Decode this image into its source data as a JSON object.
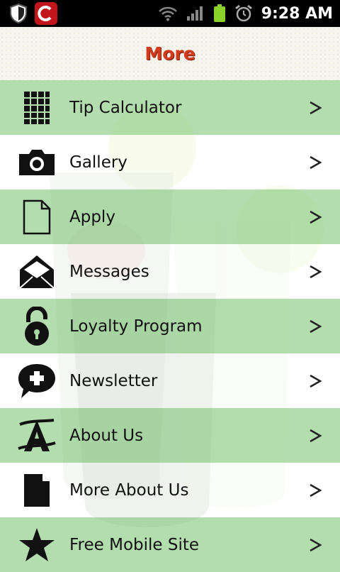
{
  "status_bar": {
    "time": "9:28 AM",
    "icons": [
      "shield-icon",
      "app-badge-icon",
      "wifi-icon",
      "signal-icon",
      "battery-icon",
      "alarm-icon"
    ]
  },
  "header": {
    "title": "More"
  },
  "colors": {
    "title": "#d23b1e",
    "row_green": "#a8d8a4",
    "row_white": "#ffffff"
  },
  "menu": {
    "items": [
      {
        "label": "Tip Calculator",
        "icon": "calculator-icon"
      },
      {
        "label": "Gallery",
        "icon": "camera-icon"
      },
      {
        "label": "Apply",
        "icon": "document-icon"
      },
      {
        "label": "Messages",
        "icon": "envelope-icon"
      },
      {
        "label": "Loyalty Program",
        "icon": "padlock-icon"
      },
      {
        "label": "Newsletter",
        "icon": "speech-bubble-plus-icon"
      },
      {
        "label": "About Us",
        "icon": "letter-a-icon"
      },
      {
        "label": "More About Us",
        "icon": "page-icon"
      },
      {
        "label": "Free Mobile Site",
        "icon": "star-icon"
      }
    ]
  }
}
